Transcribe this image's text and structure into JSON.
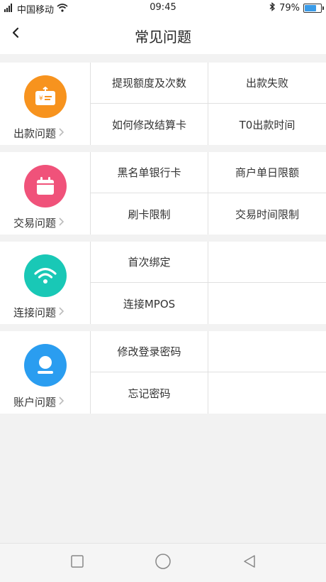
{
  "status_bar": {
    "carrier": "中国移动",
    "time": "09:45",
    "battery": "79%",
    "battery_level": 0.79
  },
  "header": {
    "title": "常见问题",
    "back_icon": "chevron-left-icon"
  },
  "sections": [
    {
      "label": "出款问题",
      "icon": "payout-card-icon",
      "color": "#f7931e",
      "items": [
        "提现额度及次数",
        "出款失败",
        "如何修改结算卡",
        "T0出款时间"
      ]
    },
    {
      "label": "交易问题",
      "icon": "calendar-icon",
      "color": "#f0527a",
      "items": [
        "黑名单银行卡",
        "商户单日限额",
        "刷卡限制",
        "交易时间限制"
      ]
    },
    {
      "label": "连接问题",
      "icon": "wifi-icon",
      "color": "#19c8b6",
      "items": [
        "首次绑定",
        "",
        "连接MPOS",
        ""
      ]
    },
    {
      "label": "账户问题",
      "icon": "user-icon",
      "color": "#2a9df0",
      "items": [
        "修改登录密码",
        "",
        "忘记密码",
        ""
      ]
    }
  ],
  "system_nav": {
    "recent_icon": "square-icon",
    "home_icon": "circle-icon",
    "back_icon": "triangle-back-icon"
  }
}
